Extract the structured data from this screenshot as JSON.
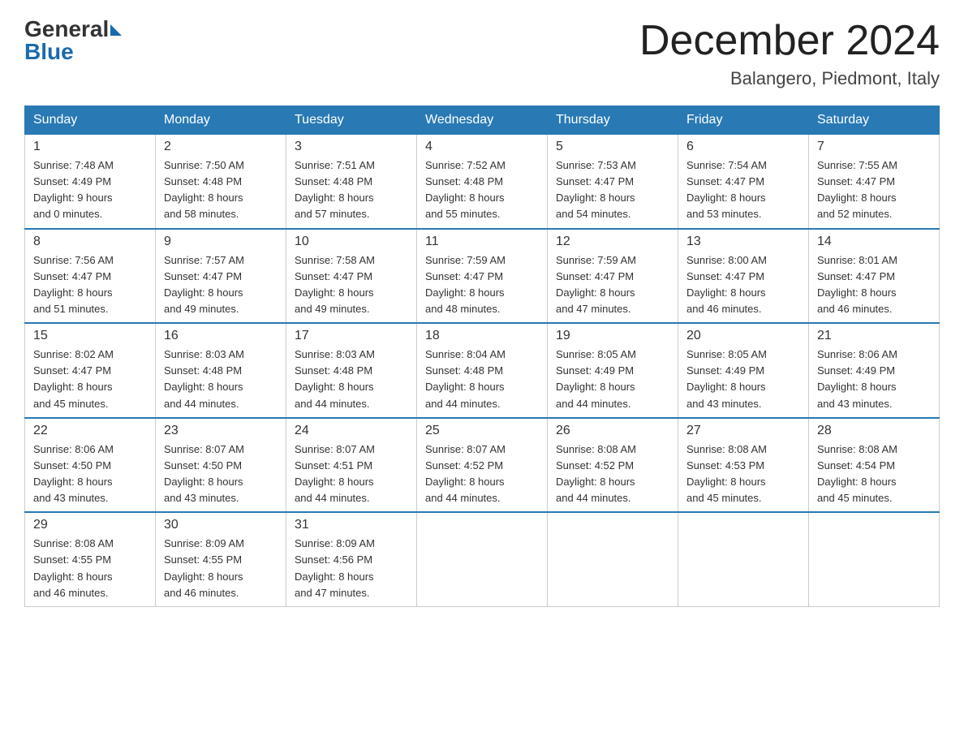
{
  "header": {
    "logo_general": "General",
    "logo_blue": "Blue",
    "month_title": "December 2024",
    "location": "Balangero, Piedmont, Italy"
  },
  "days_of_week": [
    "Sunday",
    "Monday",
    "Tuesday",
    "Wednesday",
    "Thursday",
    "Friday",
    "Saturday"
  ],
  "weeks": [
    [
      {
        "day": "1",
        "sunrise": "7:48 AM",
        "sunset": "4:49 PM",
        "daylight": "9 hours and 0 minutes."
      },
      {
        "day": "2",
        "sunrise": "7:50 AM",
        "sunset": "4:48 PM",
        "daylight": "8 hours and 58 minutes."
      },
      {
        "day": "3",
        "sunrise": "7:51 AM",
        "sunset": "4:48 PM",
        "daylight": "8 hours and 57 minutes."
      },
      {
        "day": "4",
        "sunrise": "7:52 AM",
        "sunset": "4:48 PM",
        "daylight": "8 hours and 55 minutes."
      },
      {
        "day": "5",
        "sunrise": "7:53 AM",
        "sunset": "4:47 PM",
        "daylight": "8 hours and 54 minutes."
      },
      {
        "day": "6",
        "sunrise": "7:54 AM",
        "sunset": "4:47 PM",
        "daylight": "8 hours and 53 minutes."
      },
      {
        "day": "7",
        "sunrise": "7:55 AM",
        "sunset": "4:47 PM",
        "daylight": "8 hours and 52 minutes."
      }
    ],
    [
      {
        "day": "8",
        "sunrise": "7:56 AM",
        "sunset": "4:47 PM",
        "daylight": "8 hours and 51 minutes."
      },
      {
        "day": "9",
        "sunrise": "7:57 AM",
        "sunset": "4:47 PM",
        "daylight": "8 hours and 49 minutes."
      },
      {
        "day": "10",
        "sunrise": "7:58 AM",
        "sunset": "4:47 PM",
        "daylight": "8 hours and 49 minutes."
      },
      {
        "day": "11",
        "sunrise": "7:59 AM",
        "sunset": "4:47 PM",
        "daylight": "8 hours and 48 minutes."
      },
      {
        "day": "12",
        "sunrise": "7:59 AM",
        "sunset": "4:47 PM",
        "daylight": "8 hours and 47 minutes."
      },
      {
        "day": "13",
        "sunrise": "8:00 AM",
        "sunset": "4:47 PM",
        "daylight": "8 hours and 46 minutes."
      },
      {
        "day": "14",
        "sunrise": "8:01 AM",
        "sunset": "4:47 PM",
        "daylight": "8 hours and 46 minutes."
      }
    ],
    [
      {
        "day": "15",
        "sunrise": "8:02 AM",
        "sunset": "4:47 PM",
        "daylight": "8 hours and 45 minutes."
      },
      {
        "day": "16",
        "sunrise": "8:03 AM",
        "sunset": "4:48 PM",
        "daylight": "8 hours and 44 minutes."
      },
      {
        "day": "17",
        "sunrise": "8:03 AM",
        "sunset": "4:48 PM",
        "daylight": "8 hours and 44 minutes."
      },
      {
        "day": "18",
        "sunrise": "8:04 AM",
        "sunset": "4:48 PM",
        "daylight": "8 hours and 44 minutes."
      },
      {
        "day": "19",
        "sunrise": "8:05 AM",
        "sunset": "4:49 PM",
        "daylight": "8 hours and 44 minutes."
      },
      {
        "day": "20",
        "sunrise": "8:05 AM",
        "sunset": "4:49 PM",
        "daylight": "8 hours and 43 minutes."
      },
      {
        "day": "21",
        "sunrise": "8:06 AM",
        "sunset": "4:49 PM",
        "daylight": "8 hours and 43 minutes."
      }
    ],
    [
      {
        "day": "22",
        "sunrise": "8:06 AM",
        "sunset": "4:50 PM",
        "daylight": "8 hours and 43 minutes."
      },
      {
        "day": "23",
        "sunrise": "8:07 AM",
        "sunset": "4:50 PM",
        "daylight": "8 hours and 43 minutes."
      },
      {
        "day": "24",
        "sunrise": "8:07 AM",
        "sunset": "4:51 PM",
        "daylight": "8 hours and 44 minutes."
      },
      {
        "day": "25",
        "sunrise": "8:07 AM",
        "sunset": "4:52 PM",
        "daylight": "8 hours and 44 minutes."
      },
      {
        "day": "26",
        "sunrise": "8:08 AM",
        "sunset": "4:52 PM",
        "daylight": "8 hours and 44 minutes."
      },
      {
        "day": "27",
        "sunrise": "8:08 AM",
        "sunset": "4:53 PM",
        "daylight": "8 hours and 45 minutes."
      },
      {
        "day": "28",
        "sunrise": "8:08 AM",
        "sunset": "4:54 PM",
        "daylight": "8 hours and 45 minutes."
      }
    ],
    [
      {
        "day": "29",
        "sunrise": "8:08 AM",
        "sunset": "4:55 PM",
        "daylight": "8 hours and 46 minutes."
      },
      {
        "day": "30",
        "sunrise": "8:09 AM",
        "sunset": "4:55 PM",
        "daylight": "8 hours and 46 minutes."
      },
      {
        "day": "31",
        "sunrise": "8:09 AM",
        "sunset": "4:56 PM",
        "daylight": "8 hours and 47 minutes."
      },
      null,
      null,
      null,
      null
    ]
  ]
}
